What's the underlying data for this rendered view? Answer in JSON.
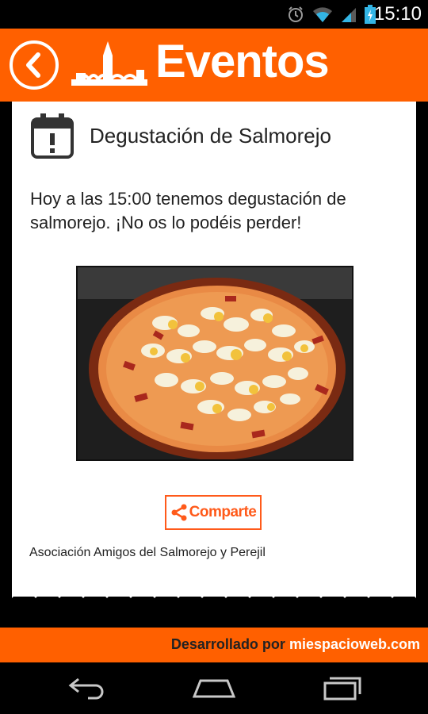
{
  "status_bar": {
    "time": "15:10"
  },
  "header": {
    "title": "Eventos",
    "accent_color": "#ff6000"
  },
  "event": {
    "title": "Degustación de Salmorejo",
    "description": "Hoy a las 15:00 tenemos degustación de salmorejo. ¡No os lo podéis perder!",
    "share_label": "Comparte",
    "organizer": "Asociación Amigos del Salmorejo y Perejil"
  },
  "footer": {
    "prefix": "Desarrollado por ",
    "link": "miespacioweb.com"
  },
  "icons": [
    "back-icon",
    "logo-icon",
    "calendar-alert-icon",
    "share-icon",
    "wifi-icon",
    "signal-icon",
    "battery-icon",
    "alarm-icon",
    "nav-back-icon",
    "nav-home-icon",
    "nav-recents-icon"
  ]
}
